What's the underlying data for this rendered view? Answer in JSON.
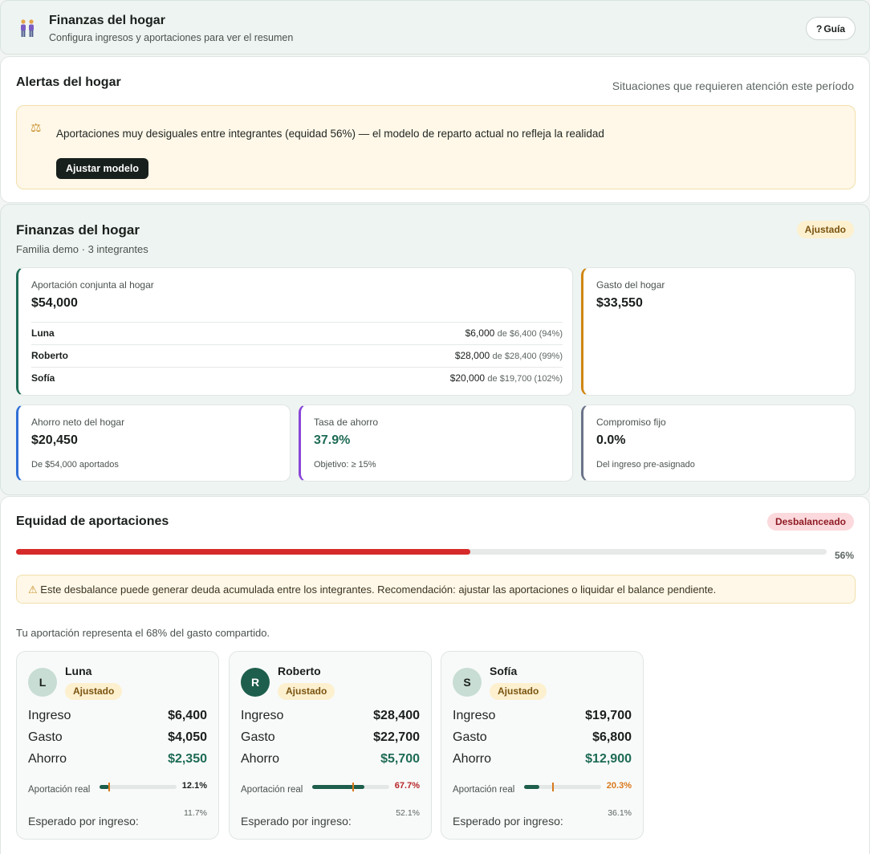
{
  "header": {
    "title": "Finanzas del hogar",
    "subtitle": "Configura ingresos y aportaciones para ver el resumen",
    "guide_label": "Guía",
    "logo_icon": "family-icon"
  },
  "alerts": {
    "title": "Alertas del hogar",
    "hint": "Situaciones que requieren atención este período",
    "items": [
      {
        "icon": "scale-icon",
        "text": "Aportaciones muy desiguales entre integrantes (equidad 56%) — el modelo de reparto actual no refleja la realidad",
        "action_label": "Ajustar modelo"
      }
    ]
  },
  "finances": {
    "title": "Finanzas del hogar",
    "subtitle": "Familia demo · 3 integrantes",
    "status_badge": "Ajustado",
    "joint": {
      "label": "Aportación conjunta al hogar",
      "value": "$54,000",
      "members": [
        {
          "name": "Luna",
          "amount": "$6,000",
          "detail": "de $6,400 (94%)"
        },
        {
          "name": "Roberto",
          "amount": "$28,000",
          "detail": "de $28,400 (99%)"
        },
        {
          "name": "Sofía",
          "amount": "$20,000",
          "detail": "de $19,700 (102%)"
        }
      ]
    },
    "spend": {
      "label": "Gasto del hogar",
      "value": "$33,550"
    },
    "savings": {
      "label": "Ahorro neto del hogar",
      "value": "$20,450",
      "foot": "De $54,000 aportados"
    },
    "rate": {
      "label": "Tasa de ahorro",
      "value": "37.9%",
      "foot": "Objetivo: ≥ 15%"
    },
    "fixed": {
      "label": "Compromiso fijo",
      "value": "0.0%",
      "foot": "Del ingreso pre-asignado"
    }
  },
  "equity": {
    "title": "Equidad de aportaciones",
    "status_badge": "Desbalanceado",
    "progress": 0.56,
    "progress_label": "56%",
    "warning_icon": "warning-icon",
    "warning": "Este desbalance puede generar deuda acumulada entre los integrantes. Recomendación: ajustar las aportaciones o liquidar el balance pendiente.",
    "share_text": "Tu aportación representa el 68% del gasto compartido.",
    "colors": {
      "bar": "#d62a2a",
      "accent": "#1e6b55",
      "warn": "#d9781a"
    },
    "stat_labels": {
      "income": "Ingreso",
      "spend": "Gasto",
      "savings": "Ahorro"
    },
    "members": [
      {
        "initial": "L",
        "name": "Luna",
        "badge": "Ajustado",
        "income": "$6,400",
        "spend": "$4,050",
        "savings": "$2,350",
        "real_label": "Aportación real",
        "real_pct": "12.1%",
        "real": 0.121,
        "expected_label": "Esperado por ingreso:",
        "expected_pct": "11.7%",
        "expected": 0.117,
        "pct_color": "#1a1f1c"
      },
      {
        "initial": "R",
        "name": "Roberto",
        "badge": "Ajustado",
        "income": "$28,400",
        "spend": "$22,700",
        "savings": "$5,700",
        "real_label": "Aportación real",
        "real_pct": "67.7%",
        "real": 0.677,
        "expected_label": "Esperado por ingreso:",
        "expected_pct": "52.1%",
        "expected": 0.521,
        "pct_color": "#b6262a"
      },
      {
        "initial": "S",
        "name": "Sofía",
        "badge": "Ajustado",
        "income": "$19,700",
        "spend": "$6,800",
        "savings": "$12,900",
        "real_label": "Aportación real",
        "real_pct": "20.3%",
        "real": 0.203,
        "expected_label": "Esperado por ingreso:",
        "expected_pct": "36.1%",
        "expected": 0.361,
        "pct_color": "#d9781a"
      }
    ]
  }
}
